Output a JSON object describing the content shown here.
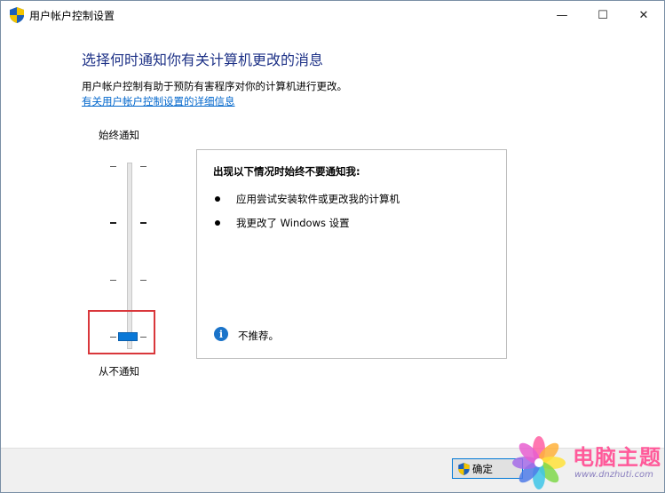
{
  "window": {
    "title": "用户帐户控制设置",
    "minimize": "—",
    "maximize": "☐",
    "close": "✕"
  },
  "main": {
    "heading": "选择何时通知你有关计算机更改的消息",
    "description": "用户帐户控制有助于预防有害程序对你的计算机进行更改。",
    "link": "有关用户帐户控制设置的详细信息"
  },
  "slider": {
    "top_label": "始终通知",
    "bottom_label": "从不通知",
    "levels": 4,
    "selected_level": 0
  },
  "panel": {
    "title": "出现以下情况时始终不要通知我:",
    "bullets": [
      "应用尝试安装软件或更改我的计算机",
      "我更改了 Windows 设置"
    ],
    "info_glyph": "i",
    "info_text": "不推荐。"
  },
  "footer": {
    "ok_label": "确定"
  },
  "watermark": {
    "title": "电脑主题",
    "url": "www.dnzhuti.com"
  },
  "colors": {
    "heading": "#1e3287",
    "link": "#0066cc",
    "thumb": "#0a78d7",
    "highlight": "#d9373b",
    "info": "#1a73c9"
  }
}
